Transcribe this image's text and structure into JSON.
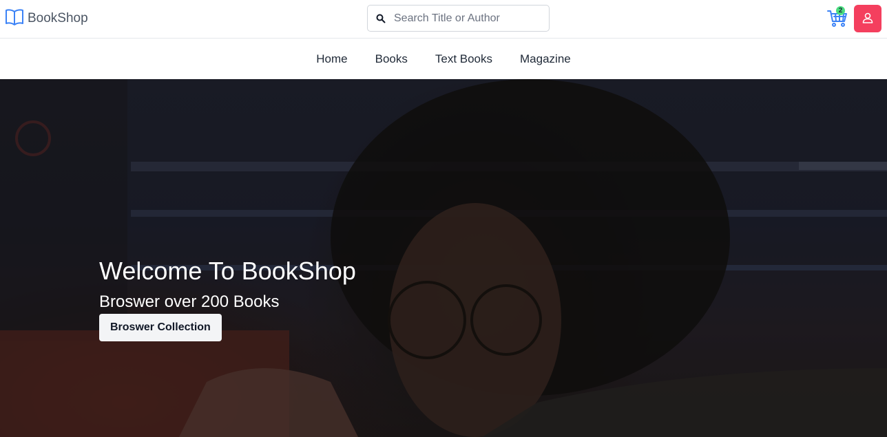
{
  "header": {
    "brand": "BookShop",
    "search": {
      "placeholder": "Search Title or Author",
      "value": ""
    },
    "cart": {
      "count": "2",
      "icon": "cart-icon"
    },
    "user_icon": "user-icon",
    "colors": {
      "brand_icon": "#3b82f6",
      "cart_icon": "#3b82f6",
      "badge": "#4ade80",
      "user_button": "#f43f5e"
    }
  },
  "nav": {
    "items": [
      {
        "label": "Home"
      },
      {
        "label": "Books"
      },
      {
        "label": "Text Books"
      },
      {
        "label": "Magazine"
      }
    ]
  },
  "hero": {
    "title": "Welcome To BookShop",
    "subtitle": "Broswer over 200 Books",
    "button": "Broswer Collection"
  }
}
